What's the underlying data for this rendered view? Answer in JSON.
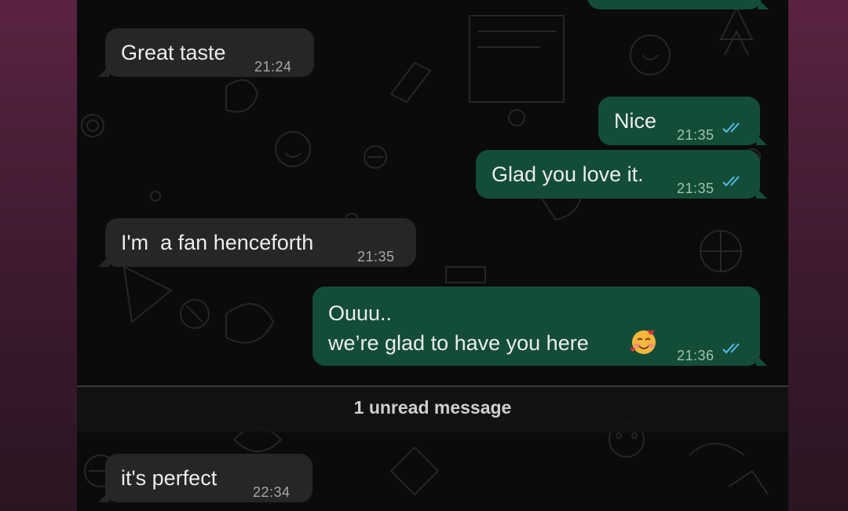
{
  "messages": [
    {
      "id": "m0",
      "direction": "outgoing",
      "text": "",
      "time": ""
    },
    {
      "id": "m1",
      "direction": "incoming",
      "text": "Great taste",
      "time": "21:24"
    },
    {
      "id": "m2",
      "direction": "outgoing",
      "text": "Nice",
      "time": "21:35",
      "status": "read"
    },
    {
      "id": "m3",
      "direction": "outgoing",
      "text": "Glad you love it.",
      "time": "21:35",
      "status": "read"
    },
    {
      "id": "m4",
      "direction": "incoming",
      "text": "I'm  a fan henceforth",
      "time": "21:35"
    },
    {
      "id": "m5",
      "direction": "outgoing",
      "line1": "Ouuu..",
      "line2": "we’re glad to have you here",
      "emoji": "smiling-face-with-hearts",
      "time": "21:36",
      "status": "read"
    },
    {
      "id": "m6",
      "direction": "incoming",
      "text": "it's perfect",
      "time": "22:34"
    }
  ],
  "unread_divider": {
    "label": "1 unread message"
  },
  "colors": {
    "incoming_bubble": "#262626",
    "outgoing_bubble": "#134d37",
    "read_ticks": "#53bdeb",
    "chat_background": "#0b0b0b"
  }
}
